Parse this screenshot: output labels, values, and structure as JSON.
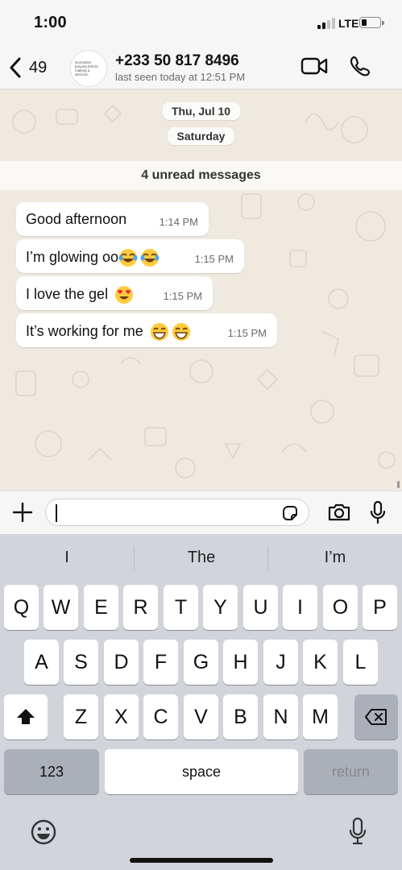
{
  "status_bar": {
    "time": "1:00",
    "network": "LTE"
  },
  "header": {
    "back_count": "49",
    "avatar_text": "Normalize praying before making a decision",
    "contact_name": "+233 50 817 8496",
    "last_seen": "last seen today at 12:51 PM"
  },
  "chat": {
    "date_pills": [
      "Thu, Jul 10",
      "Saturday"
    ],
    "unread_banner": "4 unread messages",
    "messages": [
      {
        "text": "Good afternoon",
        "time": "1:14 PM"
      },
      {
        "text": "I’m glowing oo",
        "emojis": [
          "face-with-tears-of-joy",
          "face-with-tears-of-joy"
        ],
        "time": "1:15 PM"
      },
      {
        "text": "I love the gel",
        "emojis": [
          "smiling-face-with-heart-eyes"
        ],
        "time": "1:15 PM"
      },
      {
        "text": "It’s working for me",
        "emojis": [
          "beaming-face",
          "beaming-face"
        ],
        "time": "1:15 PM"
      }
    ]
  },
  "input_bar": {
    "value": ""
  },
  "keyboard": {
    "suggestions": [
      "I",
      "The",
      "I’m"
    ],
    "row1": [
      "Q",
      "W",
      "E",
      "R",
      "T",
      "Y",
      "U",
      "I",
      "O",
      "P"
    ],
    "row2": [
      "A",
      "S",
      "D",
      "F",
      "G",
      "H",
      "J",
      "K",
      "L"
    ],
    "row3": [
      "Z",
      "X",
      "C",
      "V",
      "B",
      "N",
      "M"
    ],
    "numbers_key": "123",
    "space_key": "space",
    "return_key": "return"
  },
  "icons": {
    "back": "chevron-left-icon",
    "video_call": "video-camera-icon",
    "voice_call": "phone-icon",
    "attach": "plus-icon",
    "sticker": "sticker-icon",
    "camera": "camera-icon",
    "microphone": "microphone-icon",
    "shift": "shift-arrow-icon",
    "delete": "backspace-icon",
    "emoji": "emoji-face-icon",
    "dictation": "dictation-mic-icon"
  },
  "colors": {
    "chat_background": "#efe9df",
    "bubble": "#ffffff",
    "keyboard": "#d2d4db"
  }
}
